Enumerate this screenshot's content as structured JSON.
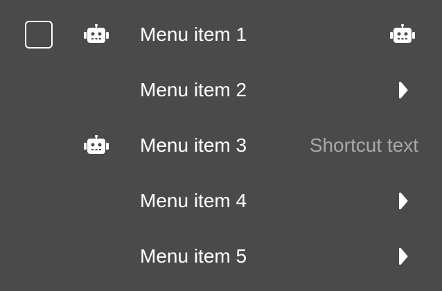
{
  "menu": {
    "items": [
      {
        "label": "Menu item 1",
        "checkbox": true,
        "leading_icon": "robot-icon",
        "trailing_icon": "robot-icon"
      },
      {
        "label": "Menu item 2",
        "trailing_icon": "chevron-right-icon"
      },
      {
        "label": "Menu item 3",
        "leading_icon": "robot-icon",
        "shortcut": "Shortcut text"
      },
      {
        "label": "Menu item 4",
        "trailing_icon": "chevron-right-icon"
      },
      {
        "label": "Menu item 5",
        "trailing_icon": "chevron-right-icon"
      }
    ]
  },
  "colors": {
    "background": "#4a4a4a",
    "text": "#ffffff",
    "shortcut_text": "#a8a8a8"
  }
}
